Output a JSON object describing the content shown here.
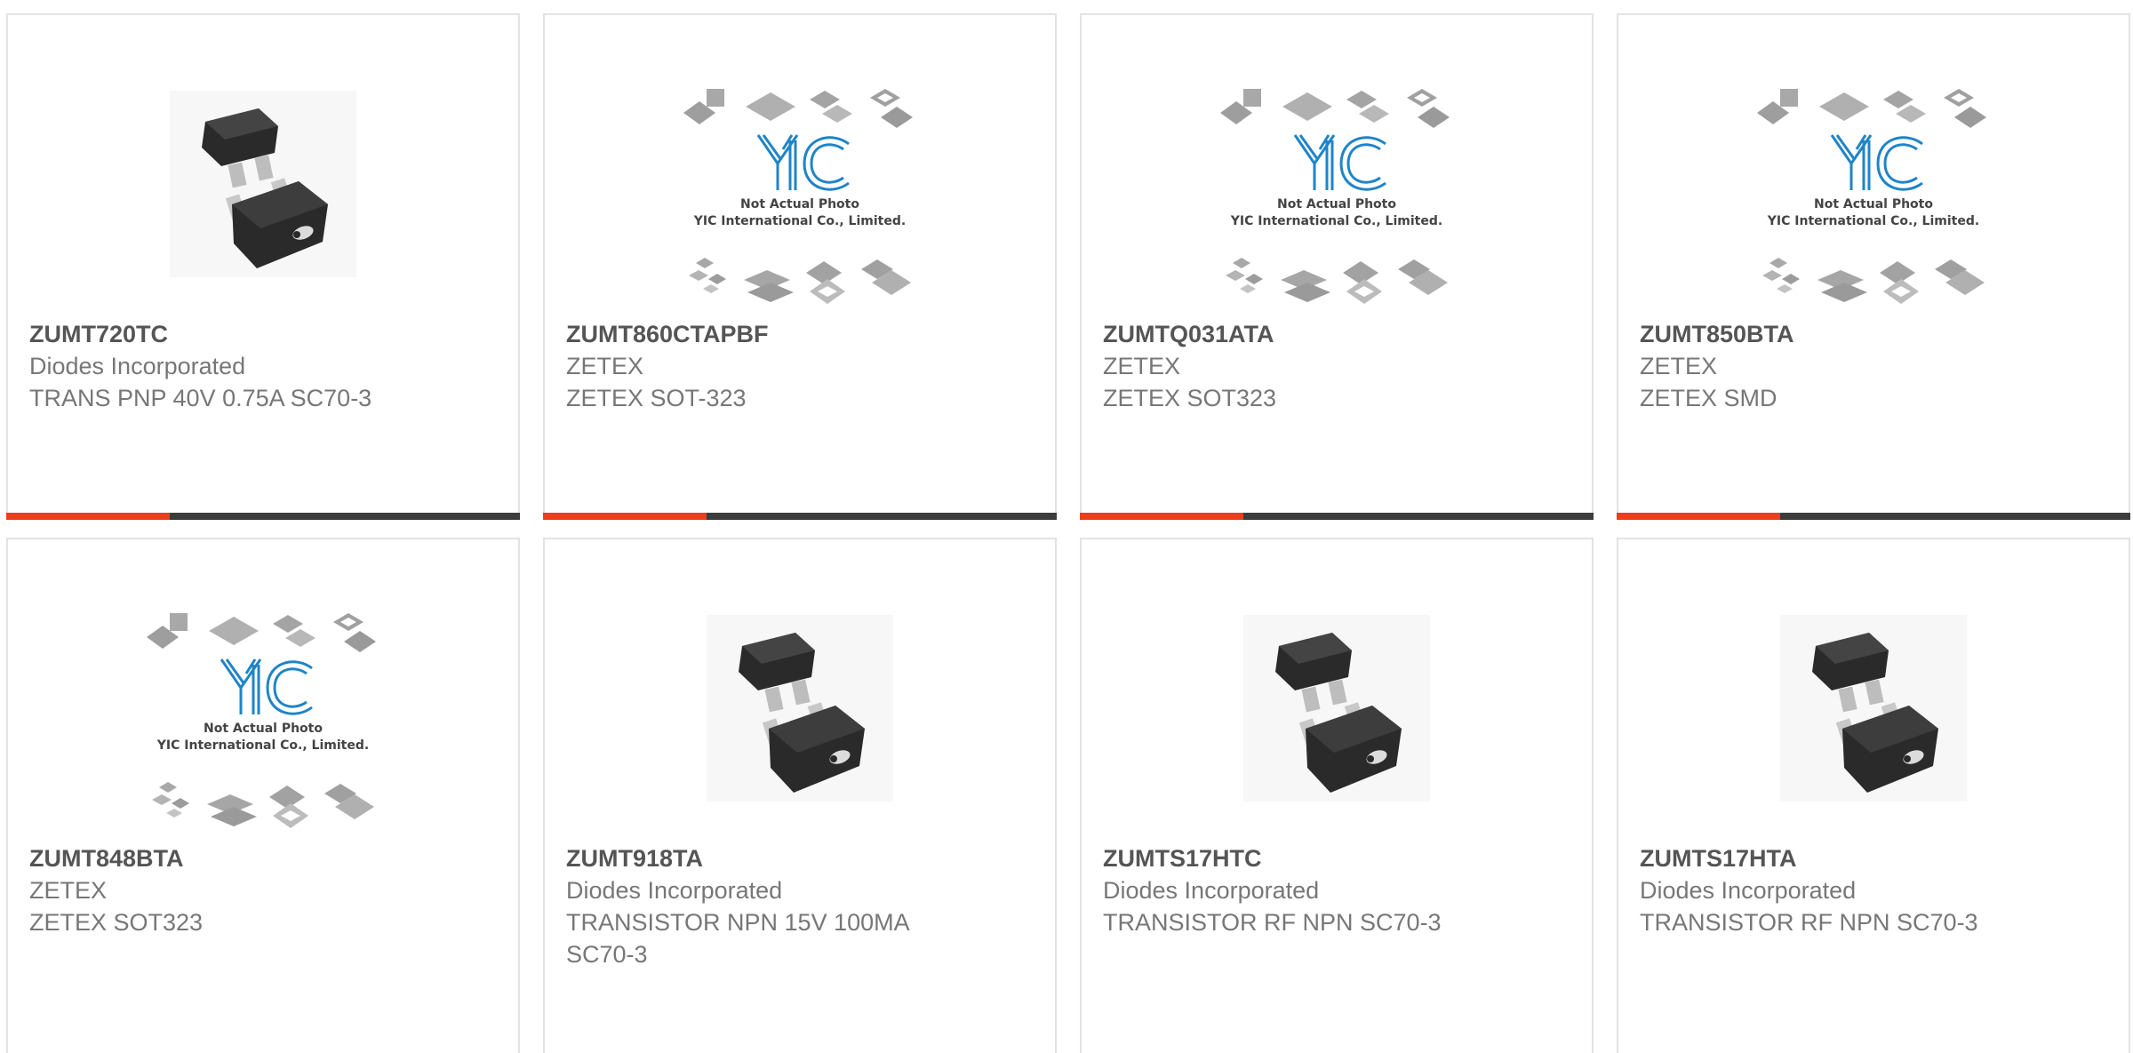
{
  "colors": {
    "accent": "#e8401c",
    "bar_dark": "#3c3c3c",
    "border": "#e3e3e3",
    "part_text": "#555555",
    "meta_text": "#777777",
    "logo_blue": "#1e84c8"
  },
  "placeholder_image": {
    "line1": "Not Actual Photo",
    "line2": "YIC International Co., Limited.",
    "logo_text": "YIC"
  },
  "products": [
    {
      "part": "ZUMT720TC",
      "manufacturer": "Diodes Incorporated",
      "description": "TRANS PNP 40V 0.75A SC70-3",
      "image": "transistor-photo",
      "show_bar": true
    },
    {
      "part": "ZUMT860CTAPBF",
      "manufacturer": "ZETEX",
      "description": "ZETEX SOT-323",
      "image": "not-actual-photo",
      "show_bar": true
    },
    {
      "part": "ZUMTQ031ATA",
      "manufacturer": "ZETEX",
      "description": "ZETEX SOT323",
      "image": "not-actual-photo",
      "show_bar": true
    },
    {
      "part": "ZUMT850BTA",
      "manufacturer": "ZETEX",
      "description": "ZETEX SMD",
      "image": "not-actual-photo",
      "show_bar": true
    },
    {
      "part": "ZUMT848BTA",
      "manufacturer": "ZETEX",
      "description": "ZETEX SOT323",
      "image": "not-actual-photo",
      "show_bar": false
    },
    {
      "part": "ZUMT918TA",
      "manufacturer": "Diodes Incorporated",
      "description": "TRANSISTOR NPN 15V 100MA SC70-3",
      "image": "transistor-photo",
      "show_bar": false
    },
    {
      "part": "ZUMTS17HTC",
      "manufacturer": "Diodes Incorporated",
      "description": "TRANSISTOR RF NPN SC70-3",
      "image": "transistor-photo",
      "show_bar": false
    },
    {
      "part": "ZUMTS17HTA",
      "manufacturer": "Diodes Incorporated",
      "description": "TRANSISTOR RF NPN SC70-3",
      "image": "transistor-photo",
      "show_bar": false
    }
  ]
}
